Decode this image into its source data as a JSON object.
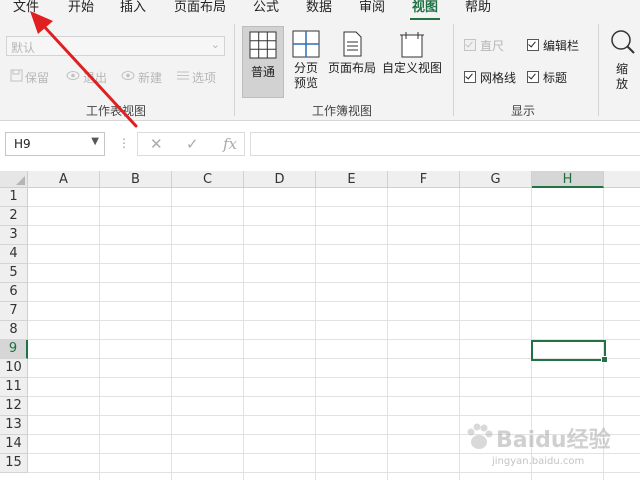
{
  "menu": {
    "items": [
      "文件",
      "开始",
      "插入",
      "页面布局",
      "公式",
      "数据",
      "审阅",
      "视图",
      "帮助"
    ],
    "active": "视图"
  },
  "ribbon": {
    "sheet_view": {
      "dropdown_value": "默认",
      "buttons": [
        "保留",
        "退出",
        "新建",
        "选项"
      ],
      "label": "工作表视图"
    },
    "workbook_views": {
      "buttons": [
        "普通",
        "分页预览",
        "页面布局",
        "自定义视图"
      ],
      "page_break_line1": "分页",
      "page_break_line2": "预览",
      "selected": "普通",
      "label": "工作簿视图"
    },
    "show": {
      "ruler": "直尺",
      "formula_bar": "编辑栏",
      "gridlines": "网格线",
      "headings": "标题",
      "label": "显示"
    },
    "zoom": {
      "line1": "缩",
      "line2": "放"
    }
  },
  "formula_bar": {
    "name_box": "H9",
    "cancel_icon": "✕",
    "enter_icon": "✓",
    "fx_label": "fx",
    "formula": ""
  },
  "grid": {
    "columns": [
      "A",
      "B",
      "C",
      "D",
      "E",
      "F",
      "G",
      "H"
    ],
    "rows": [
      "1",
      "2",
      "3",
      "4",
      "5",
      "6",
      "7",
      "8",
      "9",
      "10",
      "11",
      "12",
      "13",
      "14",
      "15"
    ],
    "selected_cell": "H9",
    "selected_column": "H",
    "selected_row": "9"
  },
  "annotation": {
    "arrow_color": "#e02020"
  },
  "watermark": {
    "text": "Baidu经验",
    "url": "jingyan.baidu.com"
  },
  "colors": {
    "accent": "#217346",
    "ribbon_bg": "#f3f3f3"
  }
}
